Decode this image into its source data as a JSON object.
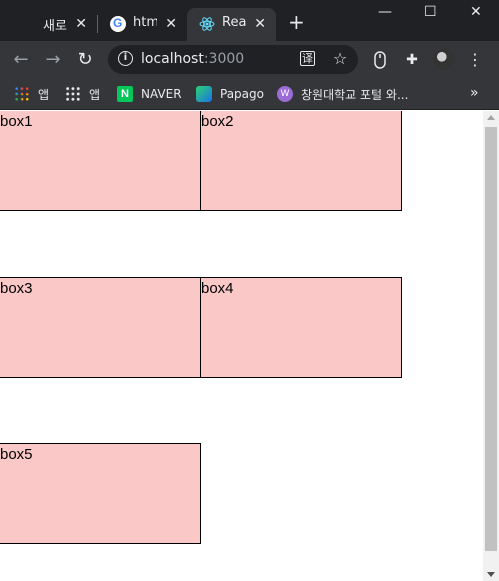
{
  "tabs": [
    {
      "label": "새로",
      "close": "✕"
    },
    {
      "label": "html",
      "close": "✕"
    },
    {
      "label": "Reac",
      "close": "✕"
    }
  ],
  "new_tab": "+",
  "window_controls": {
    "minimize": "—",
    "maximize": "☐",
    "close": "✕"
  },
  "toolbar": {
    "back": "←",
    "forward": "→",
    "reload": "↻",
    "url_host": "localhost",
    "url_port": ":3000",
    "info_icon": "i",
    "translate_icon": "译",
    "star_icon": "☆",
    "extension_icon": "✚",
    "more": "⋮"
  },
  "bookmarks": [
    {
      "label": "앱",
      "icon": "apps-color-icon"
    },
    {
      "label": "앱",
      "icon": "apps-grid-icon"
    },
    {
      "label": "NAVER",
      "icon": "naver-icon",
      "icon_text": "N"
    },
    {
      "label": "Papago",
      "icon": "papago-icon"
    },
    {
      "label": "창원대학교 포털 와...",
      "icon": "changwon-icon",
      "icon_text": "W"
    }
  ],
  "bookmarks_more": "»",
  "page": {
    "boxes": [
      {
        "label": "box1"
      },
      {
        "label": "box2"
      },
      {
        "label": "box3"
      },
      {
        "label": "box4"
      },
      {
        "label": "box5"
      }
    ],
    "box_color": "#fbc8c8"
  }
}
